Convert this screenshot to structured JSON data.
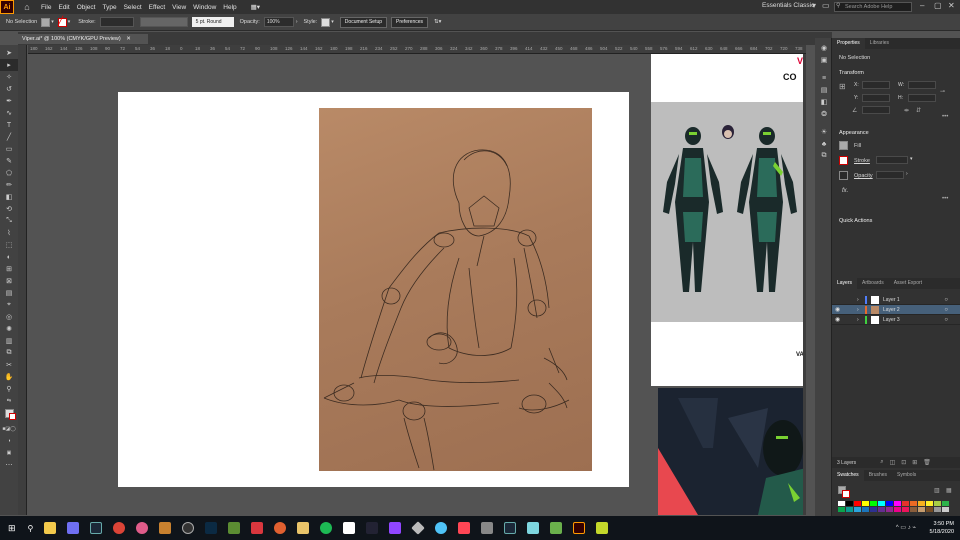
{
  "app": {
    "logo": "Ai",
    "workspace": "Essentials Classic",
    "search_placeholder": "Search Adobe Help"
  },
  "menu": [
    "File",
    "Edit",
    "Object",
    "Type",
    "Select",
    "Effect",
    "View",
    "Window",
    "Help"
  ],
  "control_bar": {
    "selection": "No Selection",
    "stroke_label": "Stroke:",
    "brush": "5 pt. Round",
    "opacity_label": "Opacity:",
    "opacity_value": "100%",
    "style_label": "Style:",
    "document_setup": "Document Setup",
    "preferences": "Preferences"
  },
  "document_tab": "Viper.ai* @ 100% (CMYK/GPU Preview)",
  "ruler_ticks": [
    "180",
    "162",
    "144",
    "126",
    "108",
    "90",
    "72",
    "54",
    "36",
    "18",
    "0",
    "18",
    "36",
    "54",
    "72",
    "90",
    "108",
    "126",
    "144",
    "162",
    "180",
    "198",
    "216",
    "234",
    "252",
    "270",
    "288",
    "306",
    "324",
    "342",
    "360",
    "378",
    "396",
    "414",
    "432",
    "450",
    "468",
    "486",
    "504",
    "522",
    "540",
    "558",
    "576",
    "594",
    "612",
    "630",
    "648",
    "666",
    "684",
    "702",
    "720",
    "738",
    "756"
  ],
  "properties": {
    "tabs": [
      "Properties",
      "Libraries"
    ],
    "selection": "No Selection",
    "transform_label": "Transform",
    "x_label": "X:",
    "y_label": "Y:",
    "w_label": "W:",
    "h_label": "H:",
    "appearance_label": "Appearance",
    "fill_label": "Fill",
    "stroke_label": "Stroke",
    "opacity_label": "Opacity",
    "fx_label": "fx.",
    "quick_actions_label": "Quick Actions"
  },
  "layers_panel": {
    "tabs": [
      "Layers",
      "Artboards",
      "Asset Export"
    ],
    "layers": [
      {
        "name": "Layer 1",
        "color": "#4f7df9",
        "visible": false,
        "selected": false
      },
      {
        "name": "Layer 2",
        "color": "#e86a2b",
        "visible": true,
        "selected": true
      },
      {
        "name": "Layer 3",
        "color": "#3fd13f",
        "visible": true,
        "selected": false
      }
    ],
    "count_label": "3 Layers"
  },
  "swatches_panel": {
    "tabs": [
      "Swatches",
      "Brushes",
      "Symbols"
    ]
  },
  "reference_image_text": {
    "top_letters": "CO",
    "bottom_letters": "VA"
  },
  "clock": {
    "time": "3:50 PM",
    "date": "5/18/2020"
  },
  "colors": {
    "accent": "#ff9a00",
    "selected_layer": "#46607a"
  }
}
